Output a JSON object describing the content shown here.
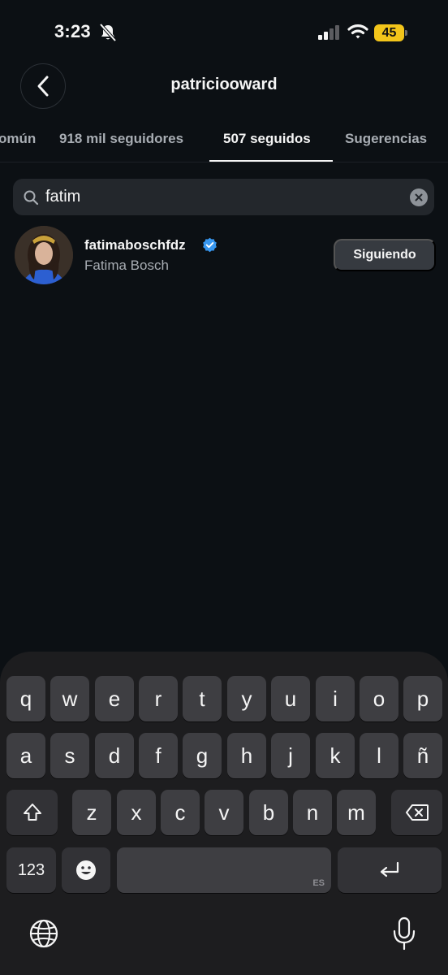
{
  "status_bar": {
    "time": "3:23",
    "battery": "45",
    "battery_color": "#f3c51a"
  },
  "header": {
    "title": "patriciooward",
    "back_icon": "chevron-left-icon"
  },
  "tabs": [
    {
      "label": "omún",
      "active": false
    },
    {
      "label": "918 mil seguidores",
      "active": false
    },
    {
      "label": "507 seguidos",
      "active": true
    },
    {
      "label": "Sugerencias",
      "active": false
    }
  ],
  "search": {
    "value": "fatim",
    "icon": "search-icon",
    "clear_icon": "close-icon"
  },
  "results": [
    {
      "username": "fatimaboschfdz",
      "full_name": "Fatima Bosch",
      "verified": true,
      "button_label": "Siguiendo"
    }
  ],
  "keyboard": {
    "row1": [
      "q",
      "w",
      "e",
      "r",
      "t",
      "y",
      "u",
      "i",
      "o",
      "p"
    ],
    "row2": [
      "a",
      "s",
      "d",
      "f",
      "g",
      "h",
      "j",
      "k",
      "l",
      "ñ"
    ],
    "row3": [
      "z",
      "x",
      "c",
      "v",
      "b",
      "n",
      "m"
    ],
    "numbers_label": "123",
    "space_lang": "ES",
    "shift_icon": "shift-icon",
    "delete_icon": "backspace-icon",
    "emoji_icon": "emoji-icon",
    "return_icon": "return-icon",
    "globe_icon": "globe-icon",
    "mic_icon": "microphone-icon"
  },
  "colors": {
    "background": "#0c1014",
    "verified_badge": "#3797f0",
    "button_bg": "#363a40"
  }
}
